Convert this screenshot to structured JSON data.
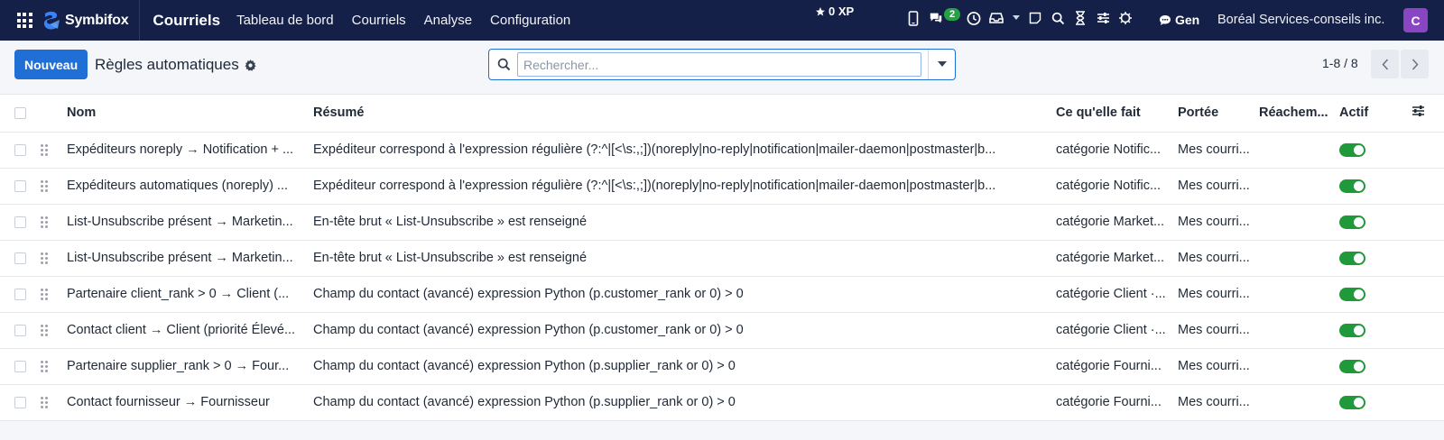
{
  "navbar": {
    "brand": "Symbifox",
    "app_title": "Courriels",
    "menu": [
      "Tableau de bord",
      "Courriels",
      "Analyse",
      "Configuration"
    ],
    "xp": "0 XP",
    "chat_badge": "2",
    "gen_label": "Gen",
    "company": "Boréal Services-conseils inc.",
    "avatar_letter": "C",
    "icons": [
      "mobile-icon",
      "chat-icon",
      "clock-icon",
      "inbox-icon",
      "caret-down-icon",
      "note-icon",
      "search-icon",
      "hourglass-icon",
      "sliders-icon",
      "bug-icon"
    ]
  },
  "control": {
    "new_button": "Nouveau",
    "page_title": "Règles automatiques",
    "search_placeholder": "Rechercher...",
    "pager": "1-8 / 8"
  },
  "table": {
    "columns": [
      "Nom",
      "Résumé",
      "Ce qu'elle fait",
      "Portée",
      "Réachem...",
      "Actif"
    ],
    "rows": [
      {
        "nom": "Expéditeurs noreply → Notification + ...",
        "resume": "Expéditeur correspond à l'expression régulière (?:^|[<\\s:,;])(noreply|no-reply|notification|mailer-daemon|postmaster|b...",
        "fait": "catégorie Notific...",
        "portee": "Mes courri...",
        "reach": "",
        "actif": true
      },
      {
        "nom": "Expéditeurs automatiques (noreply) ...",
        "resume": "Expéditeur correspond à l'expression régulière (?:^|[<\\s:,;])(noreply|no-reply|notification|mailer-daemon|postmaster|b...",
        "fait": "catégorie Notific...",
        "portee": "Mes courri...",
        "reach": "",
        "actif": true
      },
      {
        "nom": "List-Unsubscribe présent → Marketin...",
        "resume": "En-tête brut « List-Unsubscribe » est renseigné",
        "fait": "catégorie Market...",
        "portee": "Mes courri...",
        "reach": "",
        "actif": true
      },
      {
        "nom": "List-Unsubscribe présent → Marketin...",
        "resume": "En-tête brut « List-Unsubscribe » est renseigné",
        "fait": "catégorie Market...",
        "portee": "Mes courri...",
        "reach": "",
        "actif": true
      },
      {
        "nom": "Partenaire client_rank > 0 → Client (...",
        "resume": "Champ du contact (avancé) expression Python (p.customer_rank or 0) > 0",
        "fait": "catégorie Client ·...",
        "portee": "Mes courri...",
        "reach": "",
        "actif": true
      },
      {
        "nom": "Contact client → Client (priorité Élevé...",
        "resume": "Champ du contact (avancé) expression Python (p.customer_rank or 0) > 0",
        "fait": "catégorie Client ·...",
        "portee": "Mes courri...",
        "reach": "",
        "actif": true
      },
      {
        "nom": "Partenaire supplier_rank > 0 → Four...",
        "resume": "Champ du contact (avancé) expression Python (p.supplier_rank or 0) > 0",
        "fait": "catégorie Fourni...",
        "portee": "Mes courri...",
        "reach": "",
        "actif": true
      },
      {
        "nom": "Contact fournisseur → Fournisseur",
        "resume": "Champ du contact (avancé) expression Python (p.supplier_rank or 0) > 0",
        "fait": "catégorie Fourni...",
        "portee": "Mes courri...",
        "reach": "",
        "actif": true
      }
    ]
  },
  "colors": {
    "navbar_bg": "#142047",
    "primary": "#1f6fd6",
    "toggle_on": "#1f9a3a",
    "badge_green": "#25a244",
    "avatar": "#8a46c2"
  }
}
